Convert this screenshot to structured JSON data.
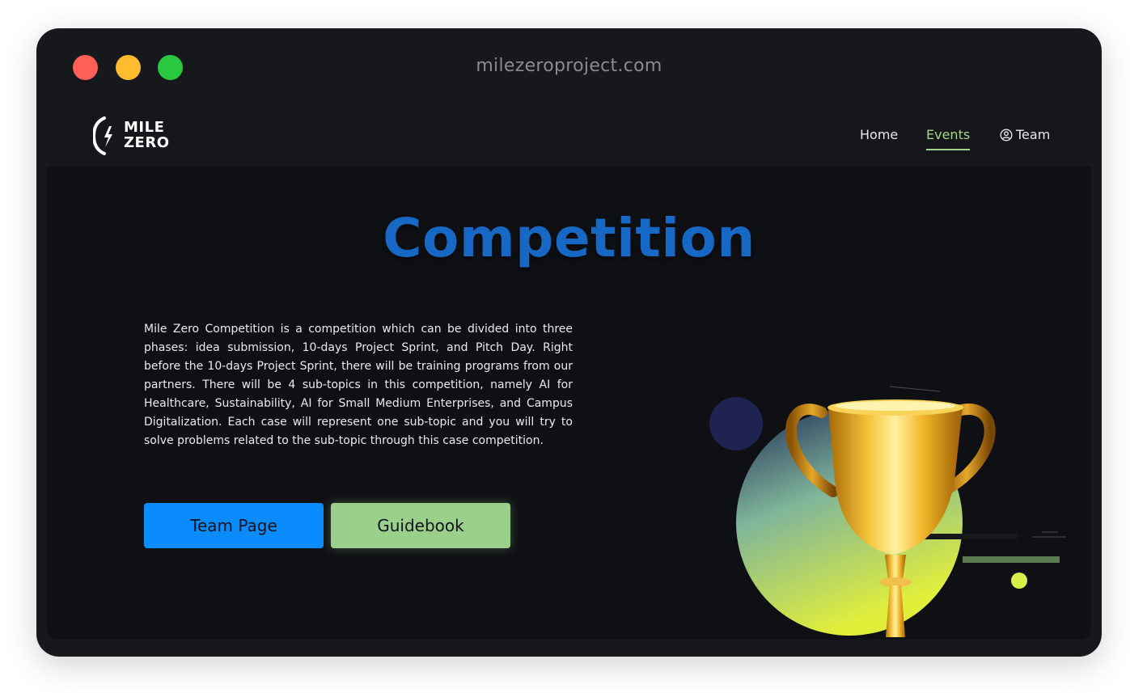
{
  "browser": {
    "url": "milezeroproject.com"
  },
  "logo": {
    "line1": "MILE",
    "line2": "ZERO"
  },
  "nav": {
    "home": "Home",
    "events": "Events",
    "team": "Team"
  },
  "hero": {
    "title": "Competition",
    "description": "Mile Zero Competition is a competition which can be divided into three phases: idea submission, 10-days Project Sprint, and Pitch Day. Right before the 10-days Project Sprint, there will be training programs from our partners. There will be 4 sub-topics in this competition, namely AI for Healthcare, Sustainability, AI for Small Medium Enterprises, and Campus Digitalization. Each case will represent one sub-topic and you will try to solve problems related to the sub-topic through this case competition."
  },
  "buttons": {
    "team_page": "Team Page",
    "guidebook": "Guidebook"
  },
  "colors": {
    "accent_blue": "#0a8cff",
    "accent_green": "#9bd08c",
    "title_blue": "#1668c4",
    "background": "#0f1014"
  },
  "icons": {
    "team": "user-circle-icon",
    "trophy": "trophy-icon"
  }
}
